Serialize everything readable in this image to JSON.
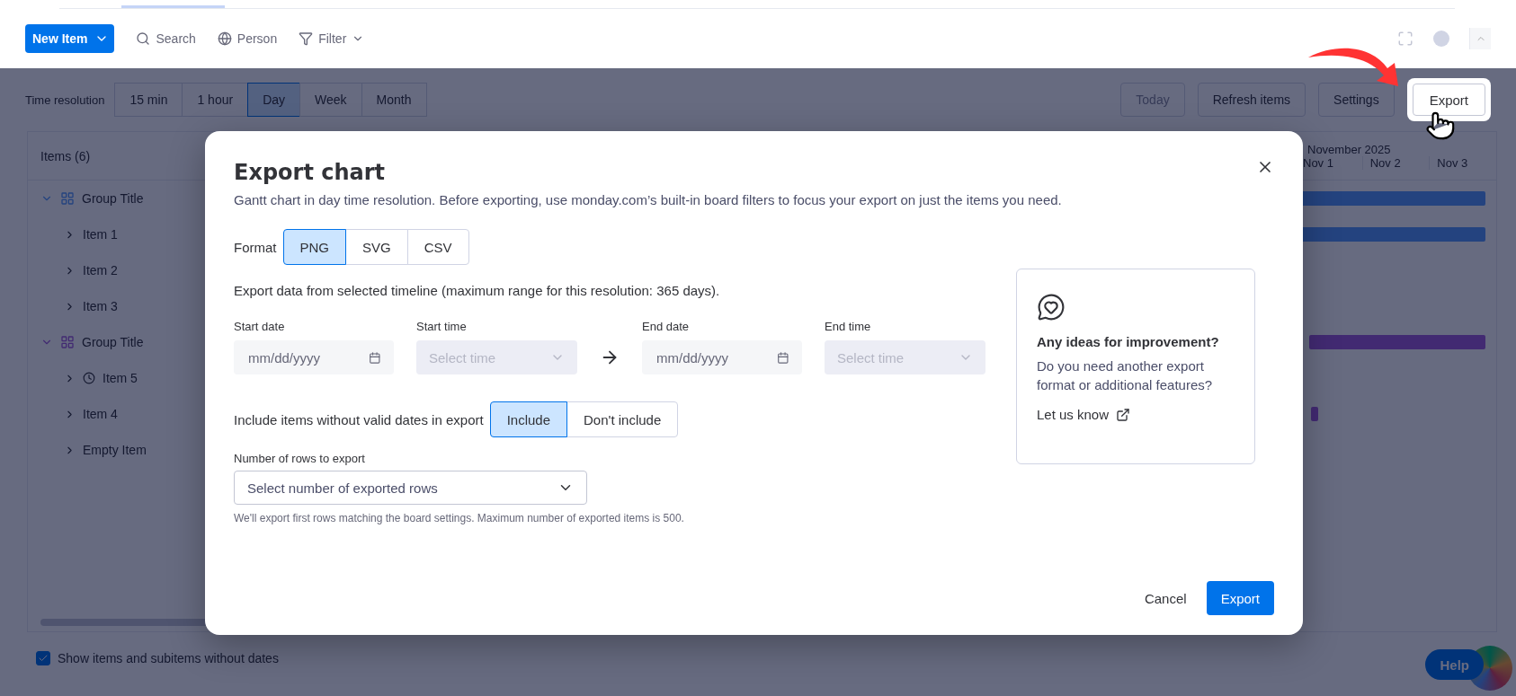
{
  "header": {
    "new_item": "New Item",
    "tools": [
      {
        "kind": "search",
        "label": "Search"
      },
      {
        "kind": "person",
        "label": "Person"
      },
      {
        "kind": "filter",
        "label": "Filter"
      }
    ]
  },
  "toolbar": {
    "resolution_label": "Time resolution",
    "resolutions": [
      {
        "label": "15 min",
        "selected": false
      },
      {
        "label": "1 hour",
        "selected": false
      },
      {
        "label": "Day",
        "selected": true
      },
      {
        "label": "Week",
        "selected": false
      },
      {
        "label": "Month",
        "selected": false
      }
    ],
    "actions": [
      {
        "label": "Today",
        "disabled": true
      },
      {
        "label": "Refresh items",
        "disabled": false
      },
      {
        "label": "Settings",
        "disabled": false
      }
    ],
    "export": "Export"
  },
  "gantt": {
    "items_header": "Items (6)",
    "month": "November 2025",
    "days": [
      "Nov 1",
      "Nov 2",
      "Nov 3"
    ],
    "groups": [
      {
        "title": "Group Title",
        "expanded": true,
        "children": [
          {
            "label": "Item 1",
            "kind": "plain",
            "expanded": false
          },
          {
            "label": "Item 2",
            "kind": "plain",
            "expanded": false
          },
          {
            "label": "Item 3",
            "kind": "plain",
            "expanded": false
          }
        ]
      },
      {
        "title": "Group Title",
        "expanded": true,
        "children": [
          {
            "label": "Item 5",
            "kind": "timed",
            "expanded": false
          },
          {
            "label": "Item 4",
            "kind": "plain",
            "expanded": false
          },
          {
            "label": "Empty Item",
            "kind": "plain",
            "expanded": false
          }
        ]
      }
    ]
  },
  "show_without_dates": {
    "label": "Show items and subitems without dates",
    "checked": true
  },
  "help": "Help",
  "dialog": {
    "title": "Export chart",
    "description": "Gantt chart in day time resolution. Before exporting, use monday.com’s built-in board filters to focus your export on just the items you need.",
    "format": {
      "label": "Format",
      "options": [
        {
          "label": "PNG",
          "selected": true
        },
        {
          "label": "SVG",
          "selected": false
        },
        {
          "label": "CSV",
          "selected": false
        }
      ]
    },
    "timeline_note": "Export data from selected timeline (maximum range for this resolution: 365 days).",
    "fields": [
      {
        "kind": "date",
        "label": "Start date",
        "placeholder": "mm/dd/yyyy",
        "disabled": false
      },
      {
        "kind": "time",
        "label": "Start time",
        "placeholder": "Select time",
        "disabled": true
      },
      {
        "kind": "date",
        "label": "End date",
        "placeholder": "mm/dd/yyyy",
        "disabled": false
      },
      {
        "kind": "time",
        "label": "End time",
        "placeholder": "Select time",
        "disabled": true
      }
    ],
    "include": {
      "label": "Include items without valid dates in export",
      "options": [
        {
          "label": "Include",
          "selected": true
        },
        {
          "label": "Don't include",
          "selected": false
        }
      ]
    },
    "rows": {
      "label": "Number of rows to export",
      "placeholder": "Select number of exported rows",
      "hint": "We'll export first rows matching the board settings. Maximum number of exported items is 500."
    },
    "feedback": {
      "title": "Any ideas for improvement?",
      "text": "Do you need another export format or additional features?",
      "link": "Let us know"
    },
    "cancel": "Cancel",
    "export": "Export"
  }
}
